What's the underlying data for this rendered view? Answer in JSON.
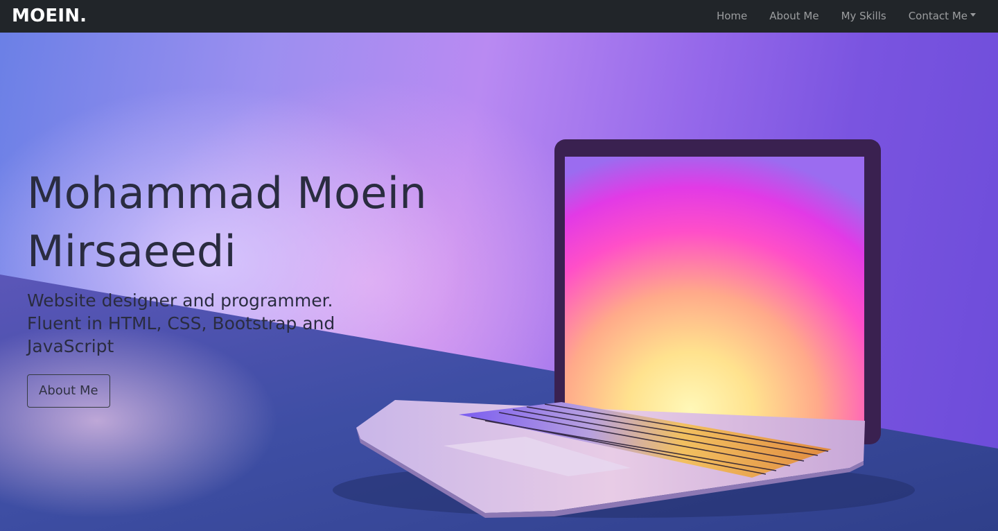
{
  "navbar": {
    "brand": "MOEIN.",
    "links": [
      {
        "label": "Home"
      },
      {
        "label": "About Me"
      },
      {
        "label": "My Skills"
      },
      {
        "label": "Contact Me"
      }
    ]
  },
  "hero": {
    "title": "Mohammad Moein Mirsaeedi",
    "subtitle": "Website designer and programmer. Fluent in HTML, CSS, Bootstrap and JavaScript",
    "button_label": "About Me",
    "image_icon": "laptop-illustration"
  },
  "colors": {
    "navbar_bg": "#212529",
    "brand_text": "#ffffff",
    "nav_link_text": "#8c8f93",
    "hero_text": "#2a2c40",
    "hero_purple": "#9c6cf0",
    "table_surface": "#3d4ea3"
  }
}
